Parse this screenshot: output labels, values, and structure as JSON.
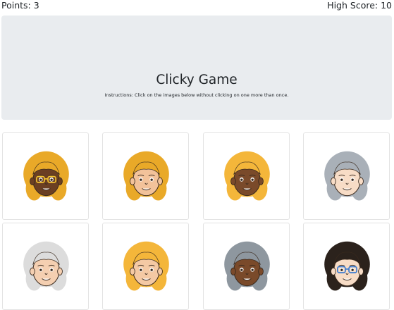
{
  "nav": {
    "points_label": "Points: 3",
    "high_score_label": "High Score: 10"
  },
  "header": {
    "title": "Clicky Game",
    "instructions": "Instructions: Click on the images below without clicking on one more than once."
  },
  "cards": [
    {
      "name": "avatar-yellow-dreadlocks-glasses",
      "hair": "#e9a928",
      "skin": "#6b3f22",
      "glasses": true,
      "glasses_color": "#f2c230"
    },
    {
      "name": "avatar-yellow-dreadlocks",
      "hair": "#e9a928",
      "skin": "#f2c29a",
      "glasses": false
    },
    {
      "name": "avatar-blonde-bob",
      "hair": "#f4b63a",
      "skin": "#7a4a2a",
      "glasses": false
    },
    {
      "name": "avatar-grey-wavy-hair",
      "hair": "#a9b0b8",
      "skin": "#f7dcc6",
      "glasses": false
    },
    {
      "name": "avatar-white-curly-hair",
      "hair": "#dcdcdc",
      "skin": "#f4cfb1",
      "glasses": false
    },
    {
      "name": "avatar-blonde-bun",
      "hair": "#f4b63a",
      "skin": "#f4c9a4",
      "glasses": false
    },
    {
      "name": "avatar-grey-curly-hair",
      "hair": "#8e979f",
      "skin": "#7a4a2a",
      "glasses": false
    },
    {
      "name": "avatar-dark-curly-hair-glasses",
      "hair": "#2b221c",
      "skin": "#f7dcc6",
      "glasses": true,
      "glasses_color": "#3b7bd1"
    }
  ]
}
